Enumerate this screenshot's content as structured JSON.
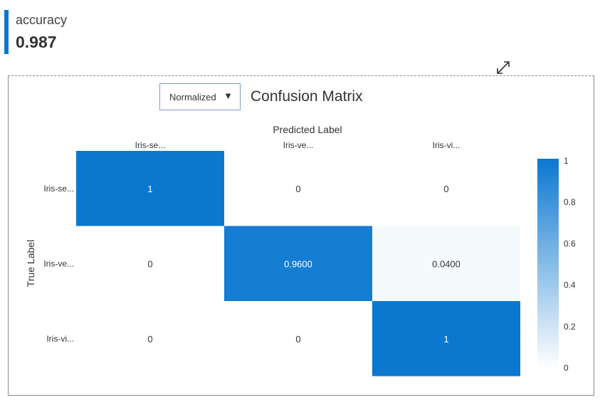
{
  "metric": {
    "label": "accuracy",
    "value": "0.987"
  },
  "controls": {
    "normalize_select": {
      "selected": "Normalized",
      "caret": "▼"
    }
  },
  "colors": {
    "accent": "#0b78d0",
    "high": "#0b78d0",
    "low": "#e6f1fb",
    "zero": "#ffffff"
  },
  "icons": {
    "expand": "expand-diagonal-arrows-icon"
  },
  "chart_data": {
    "type": "heatmap",
    "title": "Confusion Matrix",
    "xlabel": "Predicted Label",
    "ylabel": "True Label",
    "x_categories": [
      "Iris-se...",
      "Iris-ve...",
      "Iris-vi..."
    ],
    "y_categories": [
      "Iris-se...",
      "Iris-ve...",
      "Iris-vi..."
    ],
    "values": [
      [
        1,
        0,
        0
      ],
      [
        0,
        0.96,
        0.04
      ],
      [
        0,
        0,
        1
      ]
    ],
    "cell_labels": [
      [
        "1",
        "0",
        "0"
      ],
      [
        "0",
        "0.9600",
        "0.0400"
      ],
      [
        "0",
        "0",
        "1"
      ]
    ],
    "colorscale": {
      "min": 0,
      "max": 1,
      "ticks": [
        1,
        0.8,
        0.6,
        0.4,
        0.2,
        0
      ],
      "tick_labels": [
        "1",
        "0.8",
        "0.6",
        "0.4",
        "0.2",
        "0"
      ]
    },
    "legend": "right"
  }
}
